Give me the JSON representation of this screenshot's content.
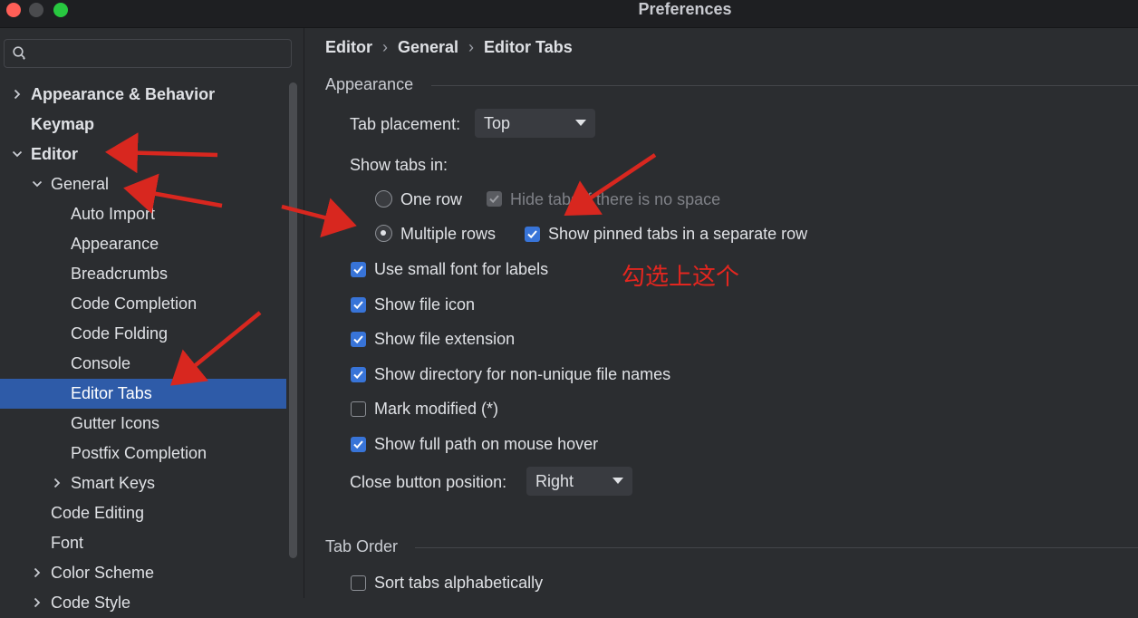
{
  "window": {
    "title": "Preferences"
  },
  "sidebar": {
    "search": {
      "placeholder": ""
    },
    "items": [
      {
        "label": "Appearance & Behavior",
        "level": 0,
        "expander": "collapsed",
        "bold": true
      },
      {
        "label": "Keymap",
        "level": 0,
        "expander": "none",
        "bold": true
      },
      {
        "label": "Editor",
        "level": 0,
        "expander": "expanded",
        "bold": true
      },
      {
        "label": "General",
        "level": 1,
        "expander": "expanded"
      },
      {
        "label": "Auto Import",
        "level": 2,
        "expander": "none"
      },
      {
        "label": "Appearance",
        "level": 2,
        "expander": "none"
      },
      {
        "label": "Breadcrumbs",
        "level": 2,
        "expander": "none"
      },
      {
        "label": "Code Completion",
        "level": 2,
        "expander": "none"
      },
      {
        "label": "Code Folding",
        "level": 2,
        "expander": "none"
      },
      {
        "label": "Console",
        "level": 2,
        "expander": "none"
      },
      {
        "label": "Editor Tabs",
        "level": 2,
        "expander": "none",
        "selected": true
      },
      {
        "label": "Gutter Icons",
        "level": 2,
        "expander": "none"
      },
      {
        "label": "Postfix Completion",
        "level": 2,
        "expander": "none"
      },
      {
        "label": "Smart Keys",
        "level": 2,
        "expander": "collapsed"
      },
      {
        "label": "Code Editing",
        "level": 1,
        "expander": "none"
      },
      {
        "label": "Font",
        "level": 1,
        "expander": "none"
      },
      {
        "label": "Color Scheme",
        "level": 1,
        "expander": "collapsed"
      },
      {
        "label": "Code Style",
        "level": 1,
        "expander": "collapsed"
      }
    ]
  },
  "main": {
    "breadcrumb": [
      "Editor",
      "General",
      "Editor Tabs"
    ],
    "appearance": {
      "title": "Appearance",
      "tab_placement_label": "Tab placement:",
      "tab_placement_value": "Top",
      "show_tabs_in_label": "Show tabs in:",
      "one_row_label": "One row",
      "one_row_selected": false,
      "hide_tabs_label": "Hide tabs if there is no space",
      "multiple_rows_label": "Multiple rows",
      "multiple_rows_selected": true,
      "show_pinned_label": "Show pinned tabs in a separate row",
      "options": [
        {
          "label": "Use small font for labels",
          "checked": true
        },
        {
          "label": "Show file icon",
          "checked": true
        },
        {
          "label": "Show file extension",
          "checked": true
        },
        {
          "label": "Show directory for non-unique file names",
          "checked": true
        },
        {
          "label": "Mark modified (*)",
          "checked": false
        },
        {
          "label": "Show full path on mouse hover",
          "checked": true
        }
      ],
      "close_button_label": "Close button position:",
      "close_button_value": "Right"
    },
    "tab_order": {
      "title": "Tab Order",
      "sort_label": "Sort tabs alphabetically",
      "sort_checked": false
    }
  },
  "annotation": {
    "text": "勾选上这个",
    "color": "#e3261f"
  },
  "colors": {
    "accent": "#3874d8",
    "selection": "#2e5ba8",
    "annotation": "#e3261f"
  }
}
